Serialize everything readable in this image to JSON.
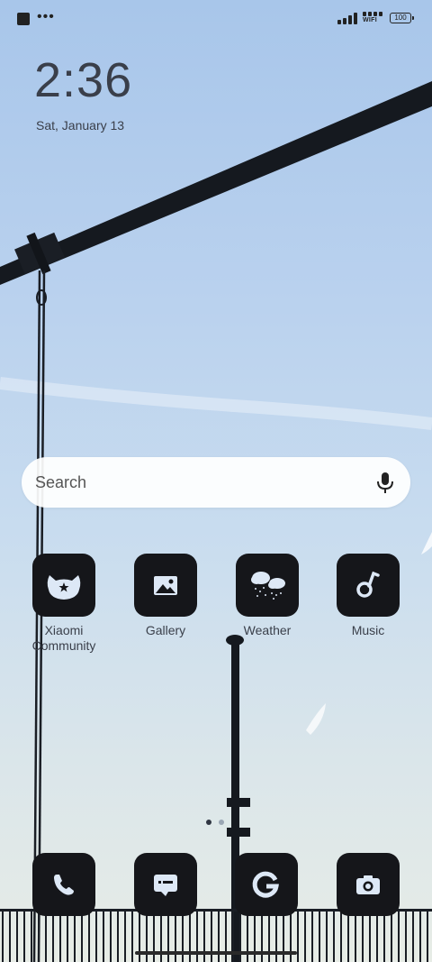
{
  "status_bar": {
    "battery": "100",
    "wifi_label": "WIFI",
    "more_indicator": "•••"
  },
  "lock": {
    "time": "2:36",
    "date": "Sat, January 13"
  },
  "search": {
    "placeholder": "Search"
  },
  "apps": [
    {
      "label": "Xiaomi Community",
      "icon": "xiaomi-community-icon"
    },
    {
      "label": "Gallery",
      "icon": "gallery-icon"
    },
    {
      "label": "Weather",
      "icon": "weather-icon"
    },
    {
      "label": "Music",
      "icon": "music-icon"
    }
  ],
  "dock": [
    {
      "icon": "phone-icon"
    },
    {
      "icon": "messages-icon"
    },
    {
      "icon": "google-icon"
    },
    {
      "icon": "camera-icon"
    }
  ],
  "pages": {
    "current": 1,
    "total": 2
  },
  "colors": {
    "icon_bg": "#15161a",
    "icon_glyph": "#dde8f6",
    "text": "#3a3f4a"
  }
}
